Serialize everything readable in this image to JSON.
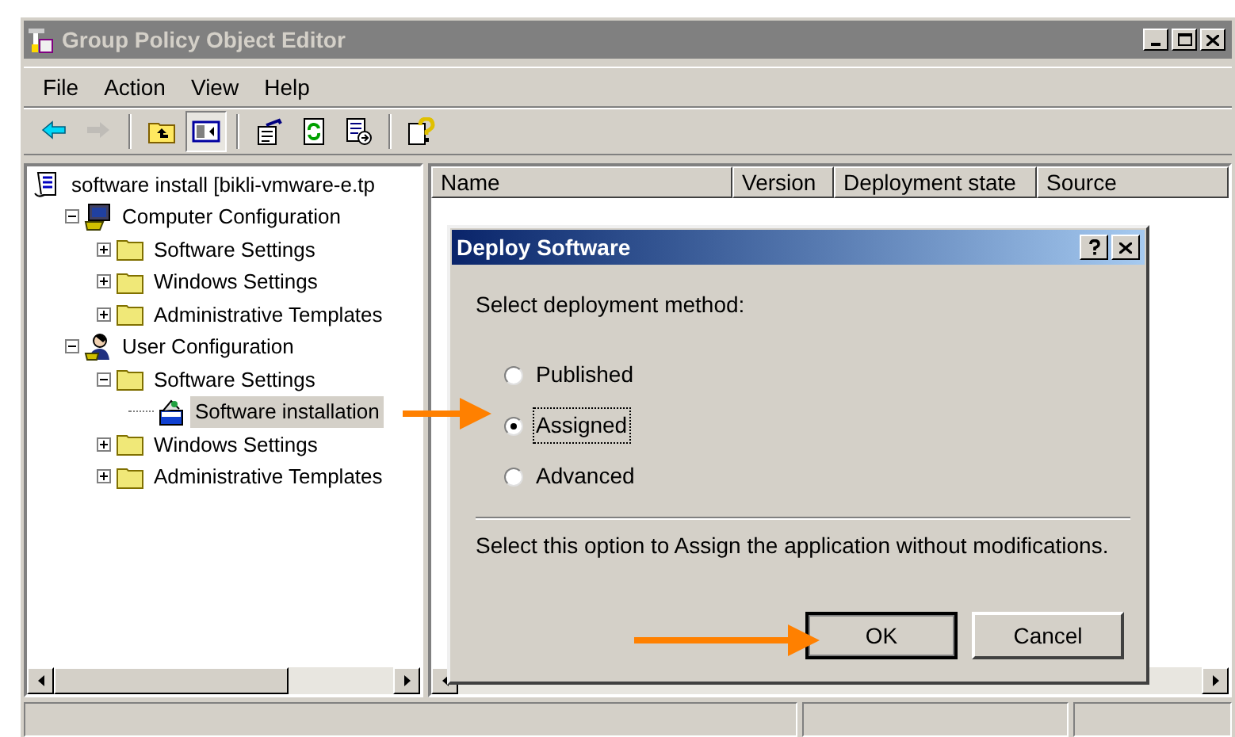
{
  "window": {
    "title": "Group Policy Object Editor"
  },
  "menu": [
    "File",
    "Action",
    "View",
    "Help"
  ],
  "toolbar": [
    {
      "kind": "back",
      "disabled": false,
      "pressed": false
    },
    {
      "kind": "forward",
      "disabled": true,
      "pressed": false
    },
    {
      "kind": "sep"
    },
    {
      "kind": "up",
      "disabled": false,
      "pressed": false
    },
    {
      "kind": "tree-toggle",
      "disabled": false,
      "pressed": true
    },
    {
      "kind": "sep"
    },
    {
      "kind": "properties",
      "disabled": false,
      "pressed": false
    },
    {
      "kind": "refresh",
      "disabled": false,
      "pressed": false
    },
    {
      "kind": "export",
      "disabled": false,
      "pressed": false
    },
    {
      "kind": "sep"
    },
    {
      "kind": "help",
      "disabled": false,
      "pressed": false
    }
  ],
  "tree": [
    {
      "label": "software install [bikli-vmware-e.tp",
      "kind": "script",
      "selected": false,
      "children": [
        {
          "label": "Computer Configuration",
          "kind": "computer",
          "expanded": true,
          "selected": false,
          "children": [
            {
              "label": "Software Settings",
              "kind": "folder",
              "expanded": false,
              "selected": false
            },
            {
              "label": "Windows Settings",
              "kind": "folder",
              "expanded": false,
              "selected": false
            },
            {
              "label": "Administrative Templates",
              "kind": "folder",
              "expanded": false,
              "selected": false
            }
          ]
        },
        {
          "label": "User Configuration",
          "kind": "user",
          "expanded": true,
          "selected": false,
          "children": [
            {
              "label": "Software Settings",
              "kind": "folder",
              "expanded": true,
              "selected": false,
              "children": [
                {
                  "label": "Software installation",
                  "kind": "package",
                  "selected": true
                }
              ]
            },
            {
              "label": "Windows Settings",
              "kind": "folder",
              "expanded": false,
              "selected": false
            },
            {
              "label": "Administrative Templates",
              "kind": "folder",
              "expanded": false,
              "selected": false
            }
          ]
        }
      ]
    }
  ],
  "list": {
    "columns": [
      "Name",
      "Version",
      "Deployment state",
      "Source"
    ]
  },
  "dialog": {
    "title": "Deploy Software",
    "prompt": "Select deployment method:",
    "options": [
      {
        "label": "Published",
        "selected": false
      },
      {
        "label": "Assigned",
        "selected": true
      },
      {
        "label": "Advanced",
        "selected": false
      }
    ],
    "description": "Select this option to Assign the application without modifications.",
    "buttons": [
      {
        "label": "OK",
        "default": true
      },
      {
        "label": "Cancel",
        "default": false
      }
    ]
  }
}
